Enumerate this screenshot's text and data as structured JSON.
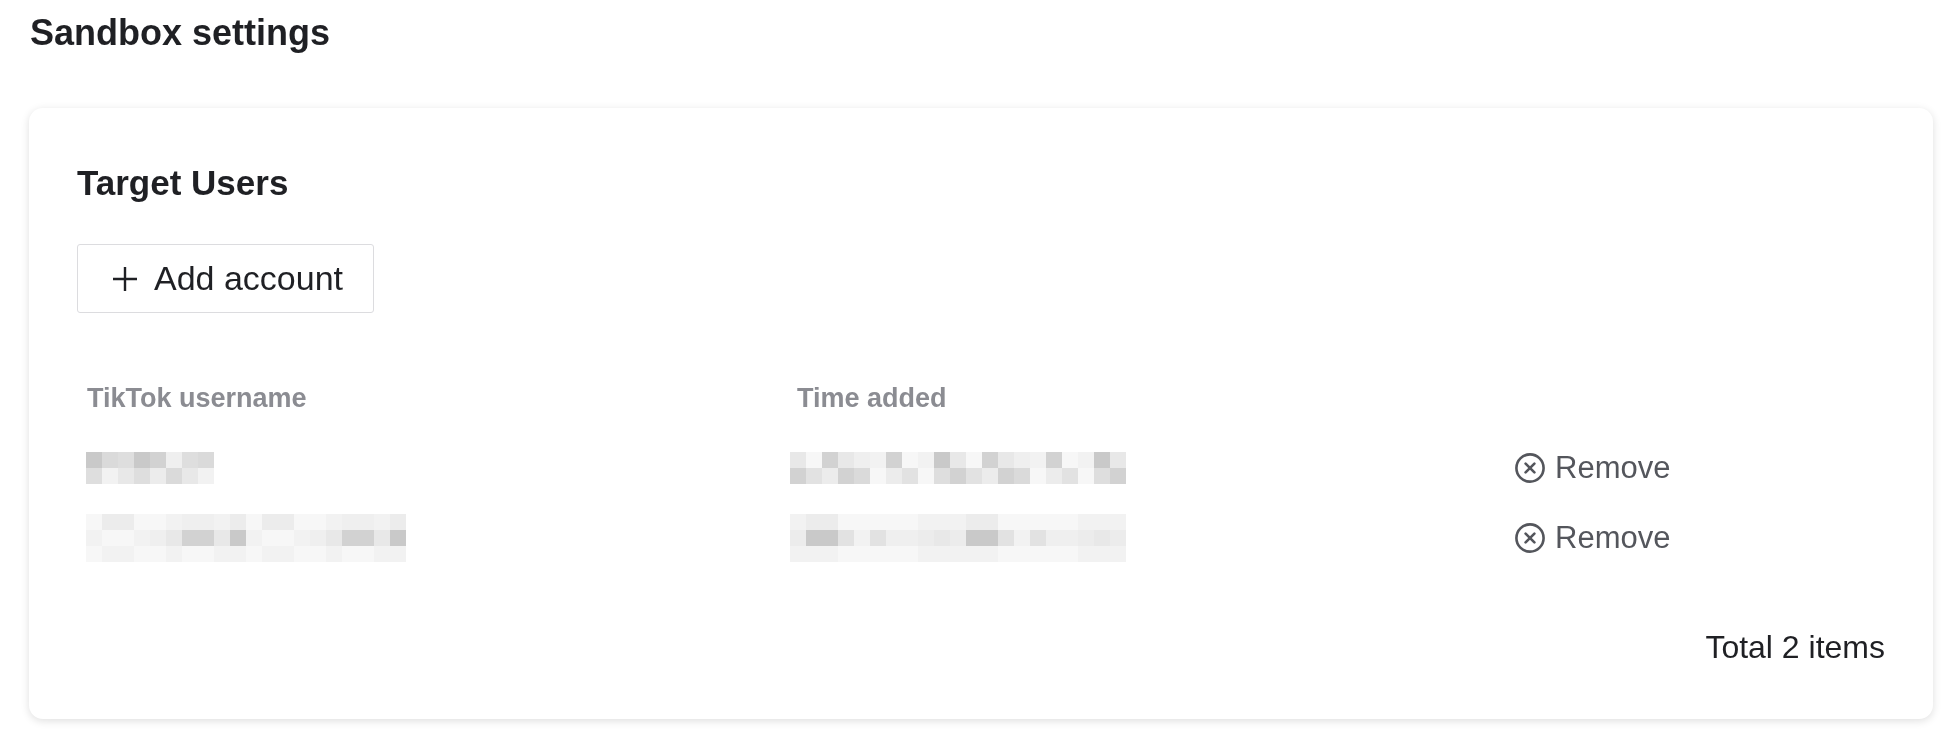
{
  "page": {
    "title": "Sandbox settings"
  },
  "target_users": {
    "title": "Target Users",
    "add_button": {
      "label": "Add account"
    },
    "table": {
      "columns": [
        {
          "label": "TikTok username"
        },
        {
          "label": "Time added"
        }
      ],
      "rows": [
        {
          "action": "Remove"
        },
        {
          "action": "Remove"
        }
      ]
    },
    "footer": {
      "total": "Total 2 items"
    }
  }
}
